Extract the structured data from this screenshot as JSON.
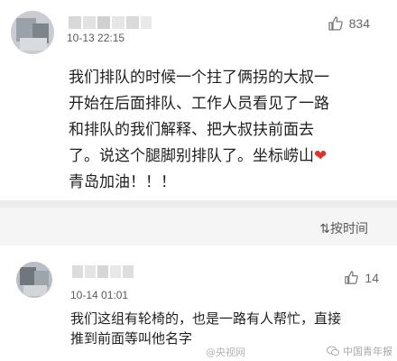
{
  "comments": [
    {
      "timestamp": "10-13 22:15",
      "like_count": "834",
      "lines": [
        "我们排队的时候一个拄了俩拐的大叔一",
        "开始在后面排队、工作人员看见了一路",
        "和排队的我们解释、把大叔扶前面去",
        "了。说这个腿脚别排队了。坐标崂山"
      ],
      "heart": "❤",
      "last_line": "青岛加油！！！"
    },
    {
      "timestamp": "10-14 01:01",
      "like_count": "14",
      "lines": [
        "我们这组有轮椅的，也是一路有人帮忙，直接",
        "推到前面等叫他名字"
      ]
    }
  ],
  "sort_label": "按时间",
  "watermarks": [
    "@央视网",
    "中国青年报"
  ],
  "colors": {
    "heart": "#e0322c",
    "divider": "#ececec",
    "subheader_bg": "#f5f5f5"
  },
  "icons": [
    "thumbs-up-icon",
    "sort-icon",
    "wechat-icon"
  ]
}
